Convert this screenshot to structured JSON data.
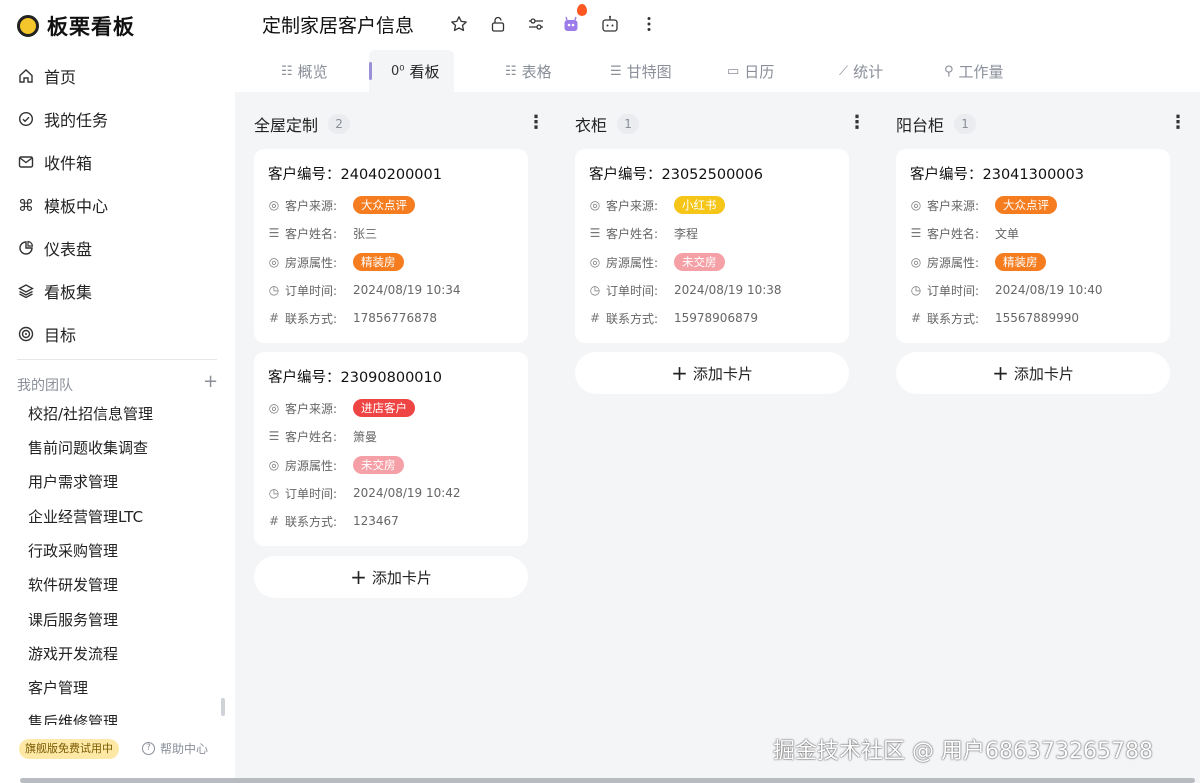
{
  "app": {
    "name": "板栗看板"
  },
  "nav": [
    {
      "label": "首页",
      "icon": "home-icon"
    },
    {
      "label": "我的任务",
      "icon": "check-circle-icon"
    },
    {
      "label": "收件箱",
      "icon": "mail-icon"
    },
    {
      "label": "模板中心",
      "icon": "command-icon"
    },
    {
      "label": "仪表盘",
      "icon": "pie-chart-icon"
    },
    {
      "label": "看板集",
      "icon": "layers-icon"
    },
    {
      "label": "目标",
      "icon": "target-icon"
    }
  ],
  "team": {
    "title": "我的团队",
    "add": "+",
    "items": [
      "校招/社招信息管理",
      "售前问题收集调查",
      "用户需求管理",
      "企业经营管理LTC",
      "行政采购管理",
      "软件研发管理",
      "课后服务管理",
      "游戏开发流程",
      "客户管理",
      "售后维修管理"
    ]
  },
  "footer": {
    "trial": "旗舰版免费试用中",
    "help": "帮助中心",
    "help_icon": "?"
  },
  "board": {
    "title": "定制家居客户信息"
  },
  "header_icons": [
    "star-icon",
    "lock-icon",
    "sliders-icon",
    "bot-avatar-icon",
    "robot-icon",
    "more-vertical-icon"
  ],
  "tabs": [
    {
      "label": "概览",
      "icon": "list-icon",
      "glyph": "☷"
    },
    {
      "label": "看板",
      "icon": "kanban-icon",
      "glyph": "0⁰"
    },
    {
      "label": "表格",
      "icon": "table-icon",
      "glyph": "☷"
    },
    {
      "label": "甘特图",
      "icon": "gantt-icon",
      "glyph": "☰"
    },
    {
      "label": "日历",
      "icon": "calendar-icon",
      "glyph": "▭"
    },
    {
      "label": "统计",
      "icon": "chart-line-icon",
      "glyph": "⟋"
    },
    {
      "label": "工作量",
      "icon": "workload-icon",
      "glyph": "⚲"
    }
  ],
  "field_labels": {
    "id_prefix": "客户编号：",
    "source": "客户来源:",
    "name": "客户姓名:",
    "property": "房源属性:",
    "time": "订单时间:",
    "contact": "联系方式:"
  },
  "colors": {
    "dianping": "#f57c1f",
    "xiaohongshu": "#f5c518",
    "walk_in": "#ef4444",
    "furnished": "#f57c1f",
    "unhanded": "#f4a0a6"
  },
  "add_card_label": "添加卡片",
  "columns": [
    {
      "title": "全屋定制",
      "count": "2",
      "cards": [
        {
          "id": "24040200001",
          "source": "大众点评",
          "name": "张三",
          "property": "精装房",
          "time": "2024/08/19 10:34",
          "contact": "17856776878"
        },
        {
          "id": "23090800010",
          "source": "进店客户",
          "name": "箫曼",
          "property": "未交房",
          "time": "2024/08/19 10:42",
          "contact": "123467"
        }
      ]
    },
    {
      "title": "衣柜",
      "count": "1",
      "cards": [
        {
          "id": "23052500006",
          "source": "小红书",
          "name": "李程",
          "property": "未交房",
          "time": "2024/08/19 10:38",
          "contact": "15978906879"
        }
      ]
    },
    {
      "title": "阳台柜",
      "count": "1",
      "cards": [
        {
          "id": "23041300003",
          "source": "大众点评",
          "name": "文单",
          "property": "精装房",
          "time": "2024/08/19 10:40",
          "contact": "15567889990"
        }
      ]
    }
  ],
  "watermark": "掘金技术社区 @ 用户686373265788"
}
